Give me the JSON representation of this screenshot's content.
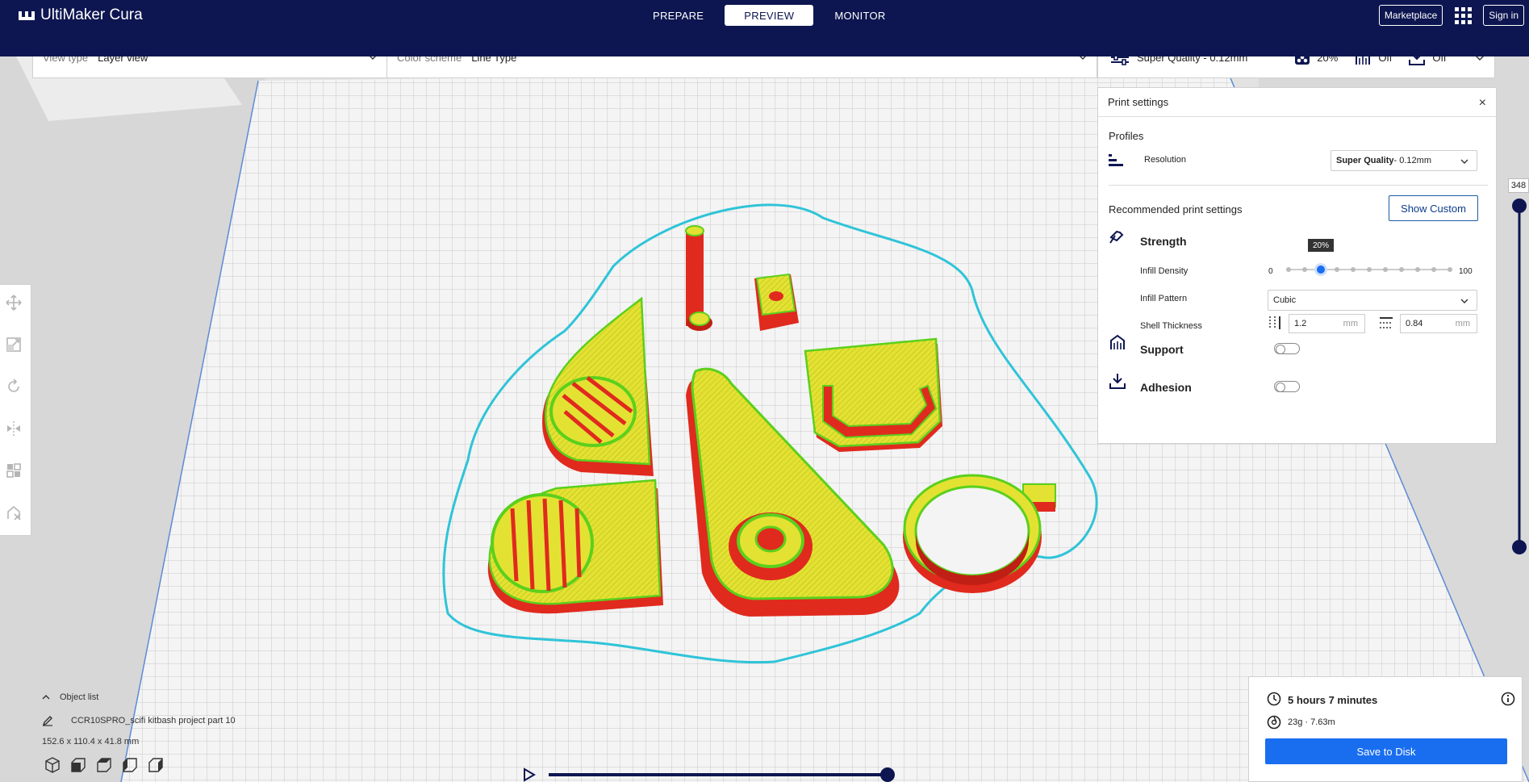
{
  "app": {
    "title": "UltiMaker Cura"
  },
  "nav": {
    "tabs": [
      {
        "label": "PREPARE",
        "active": false
      },
      {
        "label": "PREVIEW",
        "active": true
      },
      {
        "label": "MONITOR",
        "active": false
      }
    ],
    "marketplace_label": "Marketplace",
    "signin_label": "Sign in"
  },
  "viewbar": {
    "view_type_label": "View type",
    "view_type_value": "Layer view",
    "color_scheme_label": "Color scheme",
    "color_scheme_value": "Line Type"
  },
  "printbar": {
    "profile": "Super Quality - 0.12mm",
    "infill": "20%",
    "support": "Off",
    "adhesion": "Off"
  },
  "print_settings": {
    "title": "Print settings",
    "profiles_label": "Profiles",
    "resolution_label": "Resolution",
    "resolution_value_bold": "Super Quality",
    "resolution_value_rest": " - 0.12mm",
    "recommended_label": "Recommended print settings",
    "show_custom_label": "Show Custom",
    "strength_label": "Strength",
    "infill_density_label": "Infill Density",
    "infill_min": "0",
    "infill_max": "100",
    "infill_tooltip": "20%",
    "infill_fraction": 0.2,
    "infill_pattern_label": "Infill Pattern",
    "infill_pattern_value": "Cubic",
    "shell_thickness_label": "Shell Thickness",
    "wall_value": "1.2",
    "top_bottom_value": "0.84",
    "unit": "mm",
    "support_label": "Support",
    "adhesion_label": "Adhesion"
  },
  "layer_slider": {
    "top_value": "348"
  },
  "object_list": {
    "toggle_label": "Object list",
    "object_name": "CCR10SPRO_scifi kitbash project part 10",
    "dimensions": "152.6 x 110.4 x 41.8 mm"
  },
  "output": {
    "time": "5 hours 7 minutes",
    "material": "23g · 7.63m",
    "save_label": "Save to Disk"
  },
  "colors": {
    "topbar": "#0d1650",
    "accent": "#196ef0",
    "wall_red": "#e02a1e",
    "infill_yellow": "#e3e233",
    "inner_wall_green": "#5bd01c",
    "skirt_cyan": "#2fc4d8"
  }
}
